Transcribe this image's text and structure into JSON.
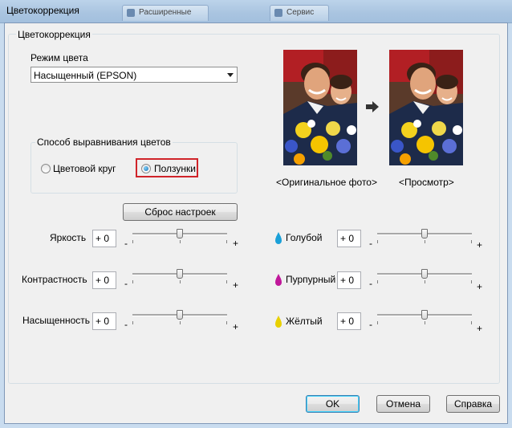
{
  "window": {
    "title": "Цветокоррекция",
    "background_tabs": [
      "Расширенные",
      "Сервис"
    ]
  },
  "group_main_label": "Цветокоррекция",
  "color_mode": {
    "label": "Режим цвета",
    "selected": "Насыщенный (EPSON)"
  },
  "alignment": {
    "label": "Способ выравнивания цветов",
    "option_circle": "Цветовой круг",
    "option_sliders": "Ползунки",
    "selected": "sliders"
  },
  "preview": {
    "original_caption": "<Оригинальное фото>",
    "preview_caption": "<Просмотр>"
  },
  "reset_button": "Сброс настроек",
  "sliders_left": [
    {
      "label": "Яркость",
      "value": "+ 0",
      "level": 0.5
    },
    {
      "label": "Контрастность",
      "value": "+ 0",
      "level": 0.5
    },
    {
      "label": "Насыщенность",
      "value": "+ 0",
      "level": 0.5
    }
  ],
  "sliders_right": [
    {
      "label": "Голубой",
      "value": "+ 0",
      "level": 0.5,
      "icon": "cyan-drop-icon",
      "color": "#1aa0d8"
    },
    {
      "label": "Пурпурный",
      "value": "+ 0",
      "level": 0.5,
      "icon": "magenta-drop-icon",
      "color": "#c0179a"
    },
    {
      "label": "Жёлтый",
      "value": "+ 0",
      "level": 0.5,
      "icon": "yellow-drop-icon",
      "color": "#e8d000"
    }
  ],
  "slider_minus": "-",
  "slider_plus": "+",
  "buttons": {
    "ok": "OK",
    "cancel": "Отмена",
    "help": "Справка"
  }
}
